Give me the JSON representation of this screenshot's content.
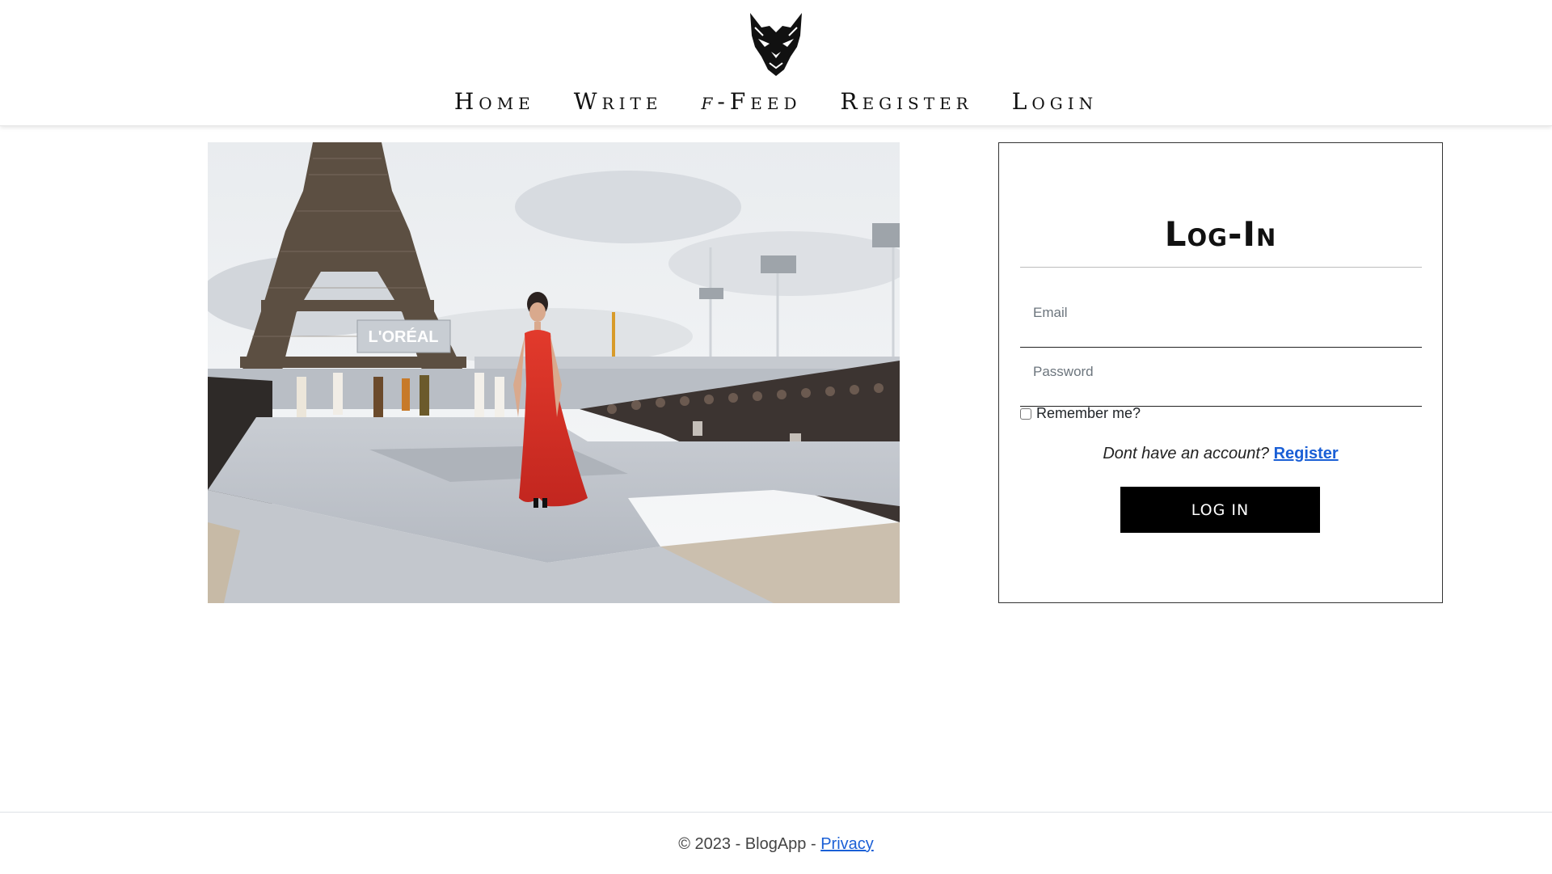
{
  "header": {
    "logo_icon": "wolf-head-logo-icon",
    "nav": [
      {
        "label": "Home"
      },
      {
        "label": "Write"
      },
      {
        "label_prefix": "f",
        "label": "-Feed"
      },
      {
        "label": "Register"
      },
      {
        "label": "Login"
      }
    ]
  },
  "hero": {
    "image_description_icon": "runway-photo",
    "sign_text": "L'ORÉAL"
  },
  "login": {
    "title": "Log-In",
    "email_label": "Email",
    "email_value": "",
    "password_label": "Password",
    "password_value": "",
    "remember_label": "Remember me?",
    "remember_checked": false,
    "no_account_text": "Dont have an account?",
    "register_link": "Register",
    "submit_label": "LOG IN"
  },
  "footer": {
    "copyright": "© 2023 - BlogApp - ",
    "privacy_link": "Privacy"
  },
  "colors": {
    "accent_link": "#1a5fd6",
    "button_bg": "#000000",
    "dress_red": "#d8322a"
  }
}
